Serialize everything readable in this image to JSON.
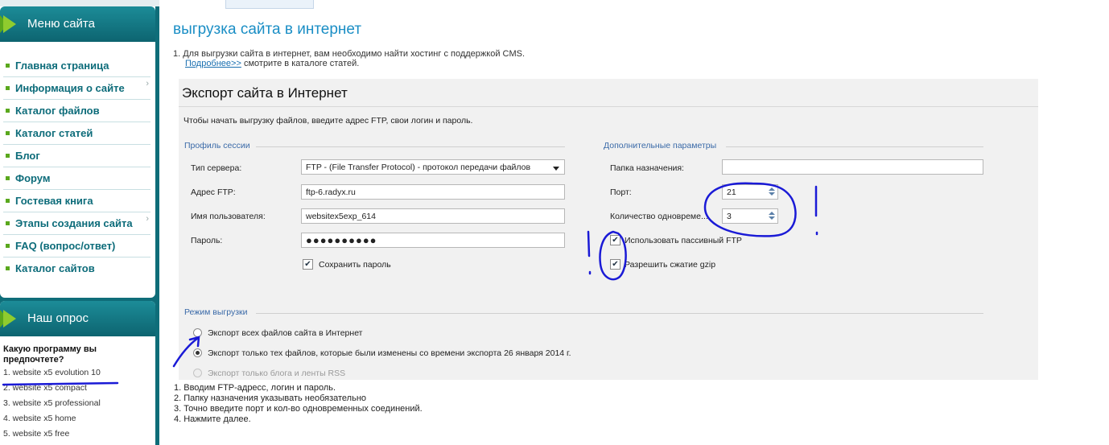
{
  "sidebar": {
    "menu_title": "Меню сайта",
    "menu_items": [
      {
        "label": "Главная страница"
      },
      {
        "label": "Информация о сайте"
      },
      {
        "label": "Каталог файлов"
      },
      {
        "label": "Каталог статей"
      },
      {
        "label": "Блог"
      },
      {
        "label": "Форум"
      },
      {
        "label": "Гостевая книга"
      },
      {
        "label": "Этапы создания сайта"
      },
      {
        "label": "FAQ (вопрос/ответ)"
      },
      {
        "label": "Каталог сайтов"
      }
    ],
    "poll_title": "Наш опрос",
    "poll_question": "Какую программу вы предпочтете?",
    "poll_options": [
      "1. website x5 evolution 10",
      "2. website x5 compact",
      "3. website x5 professional",
      "4. website x5 home",
      "5. website x5 free"
    ]
  },
  "page": {
    "title": "выгрузка сайта в интернет",
    "intro_line1": "1. Для выгрузки сайта в интернет, вам необходимо найти хостинг с поддержкой CMS.",
    "intro_link": "Подробнее>>",
    "intro_line2_rest": " смотрите в каталоге статей."
  },
  "dialog": {
    "title": "Экспорт сайта в Интернет",
    "description": "Чтобы начать выгрузку файлов, введите адрес FTP, свои логин и пароль.",
    "session_section": "Профиль сессии",
    "server_type_label": "Тип сервера:",
    "server_type_value": "FTP - (File Transfer Protocol) - протокол передачи файлов",
    "ftp_address_label": "Адрес FTP:",
    "ftp_address_value": "ftp-6.radyx.ru",
    "username_label": "Имя пользователя:",
    "username_value": "websitex5exp_614",
    "password_label": "Пароль:",
    "password_value": "●●●●●●●●●●",
    "save_password_label": "Сохранить пароль",
    "save_password_checked": true,
    "extra_section": "Дополнительные параметры",
    "dest_folder_label": "Папка назначения:",
    "dest_folder_value": "",
    "port_label": "Порт:",
    "port_value": "21",
    "connections_label": "Количество одновреме...",
    "connections_value": "3",
    "passive_ftp_label": "Использовать пассивный FTP",
    "passive_ftp_checked": true,
    "gzip_label": "Разрешить сжатие gzip",
    "gzip_checked": true,
    "mode_section": "Режим выгрузки",
    "mode_options": [
      {
        "label": "Экспорт всех файлов сайта в Интернет",
        "selected": false,
        "enabled": true
      },
      {
        "label": "Экспорт только тех файлов, которые были изменены со времени экспорта 26 января 2014 г.",
        "selected": true,
        "enabled": true
      },
      {
        "label": "Экспорт только блога и ленты RSS",
        "selected": false,
        "enabled": false
      }
    ]
  },
  "notes": [
    "1. Вводим FTP-адресс, логин и пароль.",
    "2. Папку назначения указывать необязательно",
    "3. Точно введите порт и кол-во одновременных соединений.",
    "4. Нажмите далее."
  ],
  "colors": {
    "sidebar_bg": "#0f6d79",
    "accent_green": "#8fcc2e",
    "title_blue": "#1a8ec5",
    "annotation_ink": "#1a1ad6"
  }
}
